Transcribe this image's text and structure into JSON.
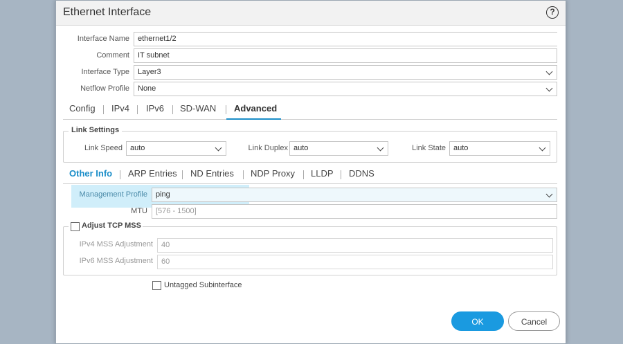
{
  "dialog": {
    "title": "Ethernet Interface",
    "help_icon": "question-circle-icon",
    "help_glyph": "?"
  },
  "general": {
    "interface_name_label": "Interface Name",
    "interface_name_value": "ethernet1/2",
    "comment_label": "Comment",
    "comment_value": "IT subnet",
    "interface_type_label": "Interface Type",
    "interface_type_value": "Layer3",
    "netflow_profile_label": "Netflow Profile",
    "netflow_profile_value": "None"
  },
  "main_tabs": [
    "Config",
    "IPv4",
    "IPv6",
    "SD-WAN",
    "Advanced"
  ],
  "main_tabs_active": "Advanced",
  "link_settings": {
    "legend": "Link Settings",
    "speed_label": "Link Speed",
    "speed_value": "auto",
    "duplex_label": "Link Duplex",
    "duplex_value": "auto",
    "state_label": "Link State",
    "state_value": "auto"
  },
  "sub_tabs": [
    "Other Info",
    "ARP Entries",
    "ND Entries",
    "NDP Proxy",
    "LLDP",
    "DDNS"
  ],
  "sub_tabs_active": "Other Info",
  "other_info": {
    "mgmt_profile_label": "Management Profile",
    "mgmt_profile_value": "ping",
    "mtu_label": "MTU",
    "mtu_placeholder": "[576 - 1500]"
  },
  "tcp_mss": {
    "legend": "Adjust TCP MSS",
    "checked": false,
    "ipv4_label": "IPv4 MSS Adjustment",
    "ipv4_value": "40",
    "ipv6_label": "IPv6 MSS Adjustment",
    "ipv6_value": "60"
  },
  "untagged": {
    "label": "Untagged Subinterface",
    "checked": false
  },
  "buttons": {
    "ok": "OK",
    "cancel": "Cancel"
  },
  "colors": {
    "accent": "#1a8dc8",
    "ok_button": "#1a9ae0",
    "highlight": "#78cdf0",
    "backdrop": "#a7b5c3"
  }
}
